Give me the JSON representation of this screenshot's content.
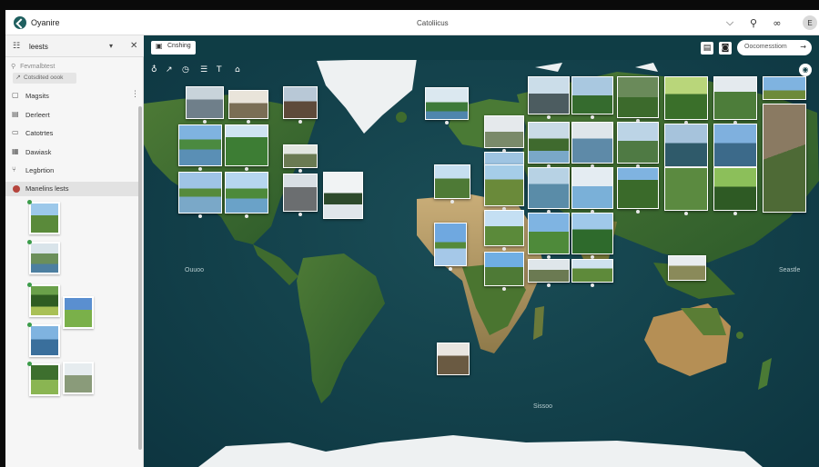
{
  "app": {
    "title": "Oyanire",
    "center_title": "Catoliicus",
    "avatar": "E"
  },
  "header_icons": [
    "chevron-down-icon",
    "search-icon",
    "link-icon"
  ],
  "sidebar": {
    "header_title": "leests",
    "search_placeholder": "Fevmalbtest",
    "chip": "Cotsdited oook",
    "items": [
      {
        "label": "Magsits",
        "icon": "square-icon"
      },
      {
        "label": "Derleert",
        "icon": "book-icon"
      },
      {
        "label": "Catotrtes",
        "icon": "chat-icon"
      },
      {
        "label": "Dawiask",
        "icon": "calendar-icon"
      },
      {
        "label": "Legbrtion",
        "icon": "tree-icon"
      },
      {
        "label": "Manelins lests",
        "icon": "pin-dot-icon"
      }
    ]
  },
  "map": {
    "toolbar_button": "Cnshing",
    "search_label": "Oocomesstiom",
    "ocean_labels": [
      "Ouuoo",
      "Sissoo",
      "Seastle"
    ]
  },
  "colors": {
    "ocean": "#123f49",
    "accent": "#1f5f5f",
    "land_green": "#3f6b2e",
    "desert": "#b79b6a",
    "ice": "#f0f2f3"
  }
}
